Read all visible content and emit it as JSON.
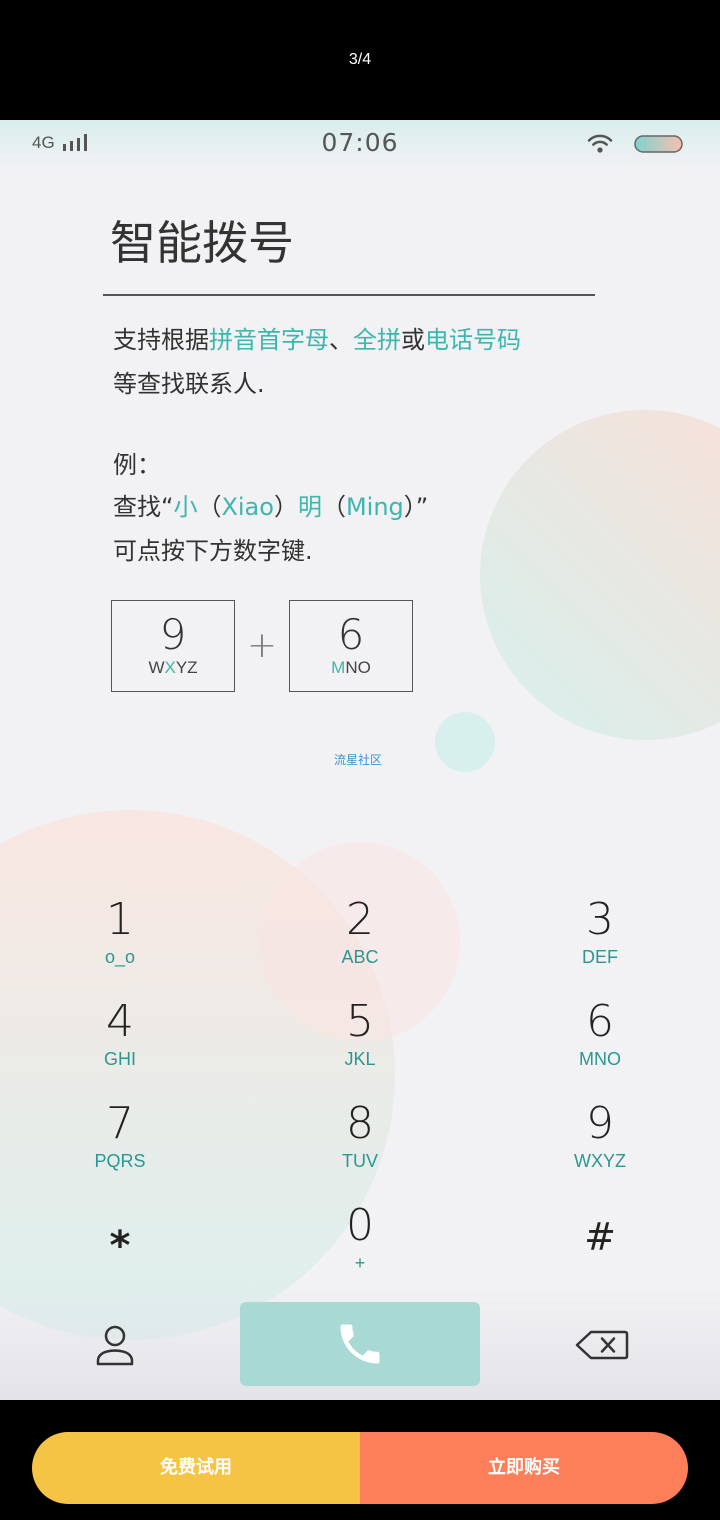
{
  "viewer": {
    "page_indicator": "3/4"
  },
  "status_bar": {
    "network_label": "4G",
    "time": "07:06",
    "icons": [
      "signal-icon",
      "wifi-icon",
      "battery-icon"
    ]
  },
  "guide": {
    "title": "智能拨号",
    "description": {
      "line1": [
        {
          "text": "支持根据",
          "highlight": false
        },
        {
          "text": "拼音首字母",
          "highlight": true
        },
        {
          "text": "、",
          "highlight": false
        },
        {
          "text": "全拼",
          "highlight": true
        },
        {
          "text": "或",
          "highlight": false
        },
        {
          "text": "电话号码",
          "highlight": true
        }
      ],
      "line2": "等查找联系人."
    },
    "example": {
      "label": "例：",
      "query": [
        {
          "text": "查找“",
          "highlight": false
        },
        {
          "text": "小",
          "highlight": true
        },
        {
          "text": "（",
          "highlight": false
        },
        {
          "text": "Xiao",
          "highlight": true
        },
        {
          "text": "）",
          "highlight": false
        },
        {
          "text": "明",
          "highlight": true
        },
        {
          "text": "（",
          "highlight": false
        },
        {
          "text": "Ming",
          "highlight": true
        },
        {
          "text": "）”",
          "highlight": false
        }
      ],
      "hint": "可点按下方数字键.",
      "keys": [
        {
          "digit": "9",
          "letters": [
            {
              "text": "W",
              "highlight": false
            },
            {
              "text": "X",
              "highlight": true
            },
            {
              "text": "YZ",
              "highlight": false
            }
          ]
        },
        {
          "digit": "6",
          "letters": [
            {
              "text": "M",
              "highlight": true
            },
            {
              "text": "NO",
              "highlight": false
            }
          ]
        }
      ],
      "plus": "+"
    }
  },
  "watermark": "流星社区",
  "keypad": {
    "keys": [
      {
        "digit": "1",
        "letters": "o_o"
      },
      {
        "digit": "2",
        "letters": "ABC"
      },
      {
        "digit": "3",
        "letters": "DEF"
      },
      {
        "digit": "4",
        "letters": "GHI"
      },
      {
        "digit": "5",
        "letters": "JKL"
      },
      {
        "digit": "6",
        "letters": "MNO"
      },
      {
        "digit": "7",
        "letters": "PQRS"
      },
      {
        "digit": "8",
        "letters": "TUV"
      },
      {
        "digit": "9",
        "letters": "WXYZ"
      },
      {
        "digit": "*",
        "letters": ""
      },
      {
        "digit": "0",
        "letters": "+"
      },
      {
        "digit": "#",
        "letters": ""
      }
    ]
  },
  "dialer_actions": {
    "icons": [
      "contact-icon",
      "phone-icon",
      "backspace-icon"
    ]
  },
  "purchase": {
    "trial_label": "免费试用",
    "buy_label": "立即购买"
  },
  "colors": {
    "accent": "#3db6ae",
    "keypad_letters": "#2b9792",
    "call_button": "#a9d9d4",
    "trial_button": "#f6c445",
    "buy_button": "#fd7f59",
    "watermark": "#3e93c9"
  }
}
